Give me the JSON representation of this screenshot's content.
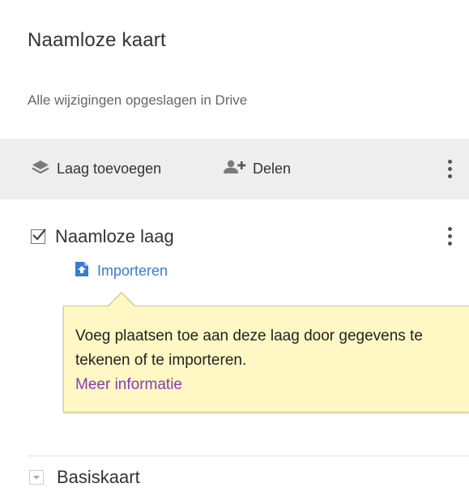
{
  "map": {
    "title": "Naamloze kaart",
    "save_status": "Alle wijzigingen opgeslagen in Drive"
  },
  "toolbar": {
    "add_layer_label": "Laag toevoegen",
    "share_label": "Delen",
    "icons": {
      "add_layer": "layers-icon",
      "share": "add-person-icon",
      "more": "more-vert-icon"
    }
  },
  "layer": {
    "name": "Naamloze laag",
    "checked": true,
    "import_label": "Importeren",
    "import_icon": "upload-file-icon"
  },
  "tooltip": {
    "text": "Voeg plaatsen toe aan deze laag door gegevens te tekenen of te importeren.",
    "link_label": "Meer informatie"
  },
  "basemap": {
    "label": "Basiskaart"
  },
  "colors": {
    "toolbar_bg": "#eeeeee",
    "link_blue": "#3a7bd5",
    "link_purple": "#8a3ab9",
    "tooltip_bg": "#fff8c4"
  }
}
